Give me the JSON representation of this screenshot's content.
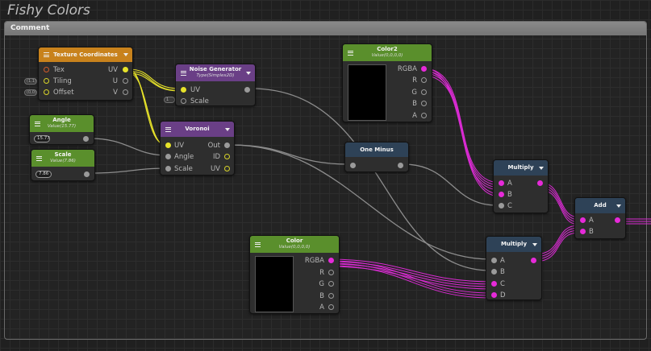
{
  "title": "Fishy Colors",
  "comment": {
    "label": "Comment"
  },
  "colors": {
    "yellow": "#e6e22a",
    "magenta": "#e62ad9",
    "grey": "#9a9a9a",
    "green_header": "#5a8f2c",
    "orange_header": "#c8821c",
    "purple_header": "#6a3f86",
    "blue_header": "#2e4257"
  },
  "nodes": {
    "texcoord": {
      "title": "Texture Coordinates",
      "inputs": [
        "Tex",
        "Tiling",
        "Offset"
      ],
      "outputs": [
        "UV",
        "U",
        "V"
      ],
      "vec_stubs": [
        "(1,1)",
        "(0,0)"
      ]
    },
    "noise": {
      "title": "Noise Generator",
      "subtitle": "Type(Simplex2D)",
      "inputs": [
        "UV",
        "Scale"
      ],
      "scale_stub": "1"
    },
    "angle": {
      "title": "Angle",
      "subtitle": "Value(15.77)",
      "value": "15.77"
    },
    "scale": {
      "title": "Scale",
      "subtitle": "Value(7.86)",
      "value": "7.86"
    },
    "voronoi": {
      "title": "Voronoi",
      "inputs": [
        "UV",
        "Angle",
        "Scale"
      ],
      "outputs": [
        "Out",
        "ID",
        "UV"
      ]
    },
    "color2": {
      "title": "Color2",
      "subtitle": "Value(0,0,0,0)",
      "outputs": [
        "RGBA",
        "R",
        "G",
        "B",
        "A"
      ]
    },
    "oneminus": {
      "title": "One Minus"
    },
    "multiply1": {
      "title": "Multiply",
      "inputs": [
        "A",
        "B",
        "C"
      ]
    },
    "add": {
      "title": "Add",
      "inputs": [
        "A",
        "B"
      ]
    },
    "color": {
      "title": "Color",
      "subtitle": "Value(0,0,0,0)",
      "outputs": [
        "RGBA",
        "R",
        "G",
        "B",
        "A"
      ]
    },
    "multiply2": {
      "title": "Multiply",
      "inputs": [
        "A",
        "B",
        "C",
        "D"
      ]
    }
  }
}
